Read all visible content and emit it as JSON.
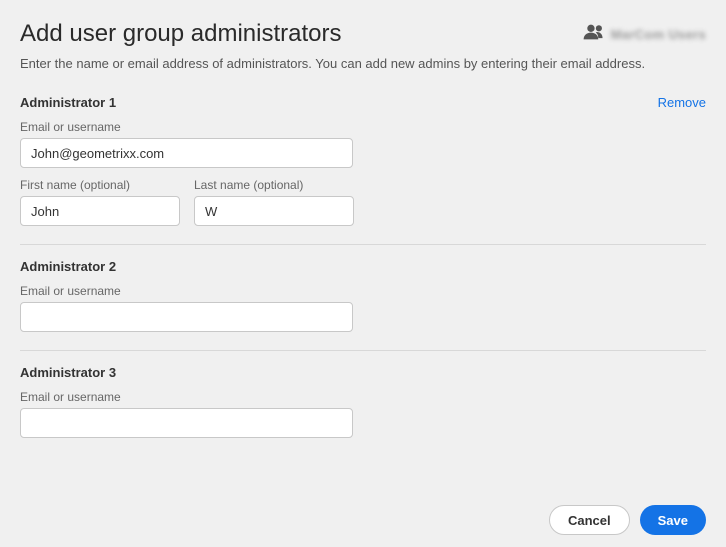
{
  "header": {
    "title": "Add user group administrators",
    "group_label": "MarCom Users",
    "subtitle": "Enter the name or email address of administrators. You can add new admins by entering their email address."
  },
  "labels": {
    "email_or_username": "Email or username",
    "first_name": "First name (optional)",
    "last_name": "Last name (optional)",
    "remove": "Remove"
  },
  "admins": [
    {
      "heading": "Administrator 1",
      "email": "John@geometrixx.com",
      "first_name": "John",
      "last_name": "W",
      "removable": true,
      "expanded": true
    },
    {
      "heading": "Administrator 2",
      "email": "",
      "removable": false,
      "expanded": false
    },
    {
      "heading": "Administrator 3",
      "email": "",
      "removable": false,
      "expanded": false
    }
  ],
  "footer": {
    "cancel": "Cancel",
    "save": "Save"
  }
}
